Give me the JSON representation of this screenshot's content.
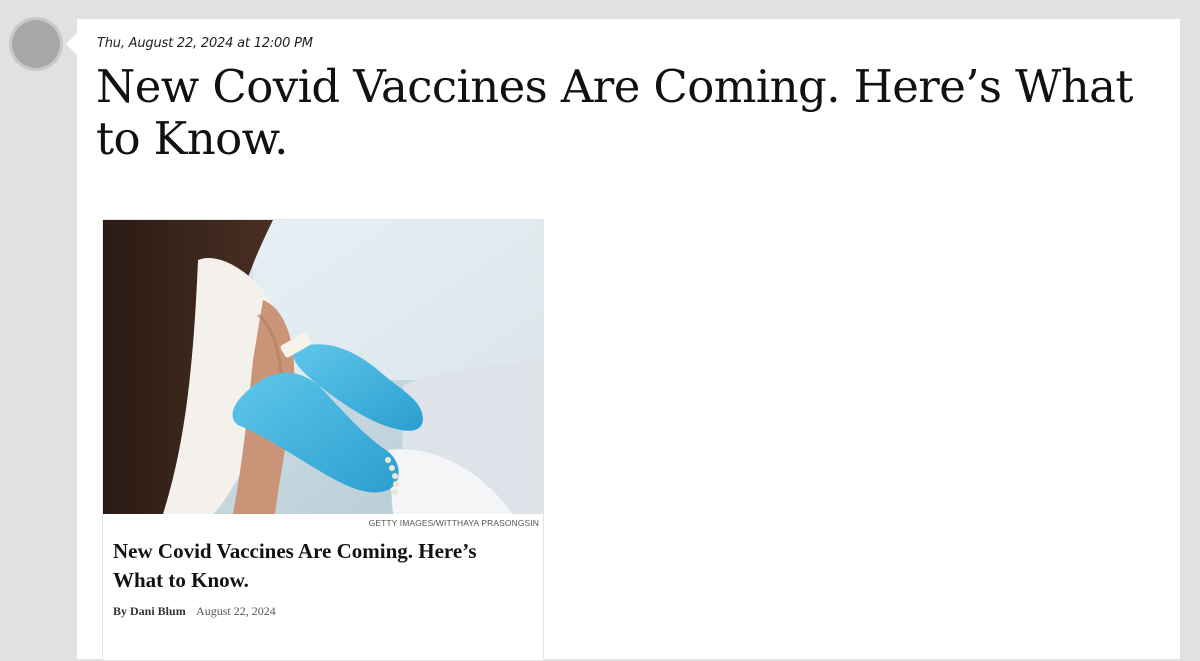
{
  "post": {
    "timestamp": "Thu, August 22, 2024 at 12:00 PM",
    "headline": "New Covid Vaccines Are Coming. Here’s What to Know."
  },
  "link_card": {
    "image_credit": "GETTY IMAGES/WITTHAYA PRASONGSIN",
    "title": "New Covid Vaccines Are Coming. Here’s What to Know.",
    "author": "By Dani Blum",
    "date": "August 22, 2024"
  }
}
